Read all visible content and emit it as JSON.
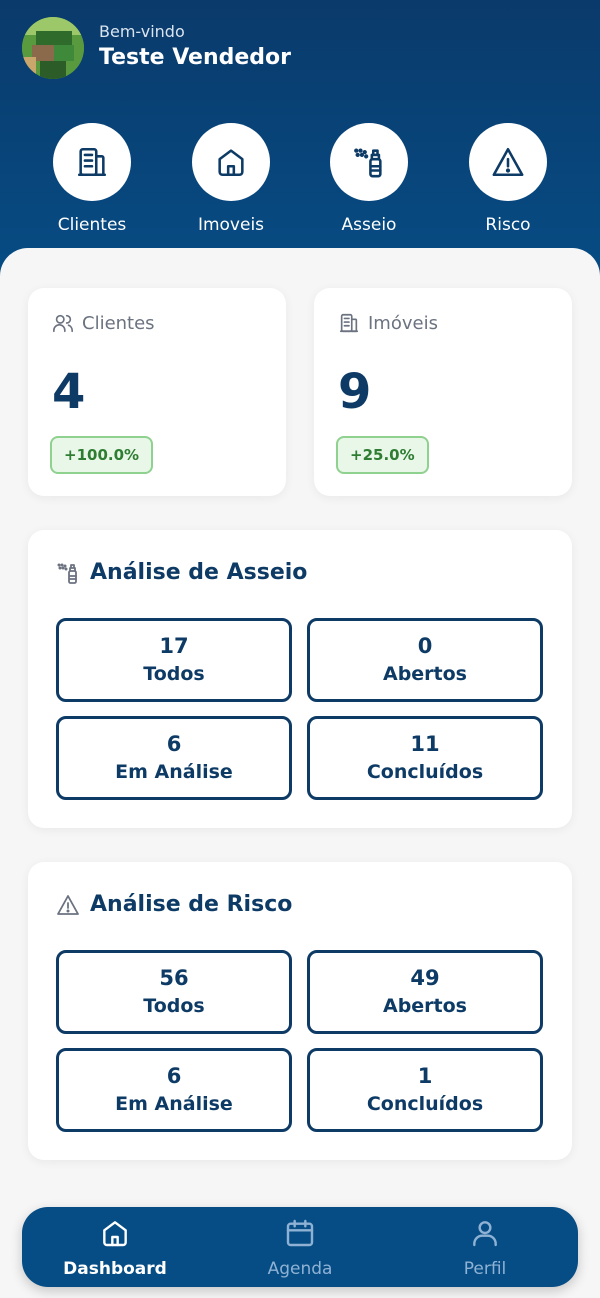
{
  "header": {
    "welcome": "Bem-vindo",
    "username": "Teste Vendedor"
  },
  "quick_actions": [
    {
      "label": "Clientes",
      "icon": "building-icon"
    },
    {
      "label": "Imoveis",
      "icon": "home-icon"
    },
    {
      "label": "Asseio",
      "icon": "spray-icon"
    },
    {
      "label": "Risco",
      "icon": "warning-icon"
    }
  ],
  "stats": [
    {
      "title": "Clientes",
      "value": "4",
      "change": "+100.0%",
      "icon": "users-icon"
    },
    {
      "title": "Imóveis",
      "value": "9",
      "change": "+25.0%",
      "icon": "building-icon"
    }
  ],
  "asseio": {
    "title": "Análise de Asseio",
    "tiles": [
      {
        "value": "17",
        "label": "Todos"
      },
      {
        "value": "0",
        "label": "Abertos"
      },
      {
        "value": "6",
        "label": "Em Análise"
      },
      {
        "value": "11",
        "label": "Concluídos"
      }
    ]
  },
  "risco": {
    "title": "Análise de Risco",
    "tiles": [
      {
        "value": "56",
        "label": "Todos"
      },
      {
        "value": "49",
        "label": "Abertos"
      },
      {
        "value": "6",
        "label": "Em Análise"
      },
      {
        "value": "1",
        "label": "Concluídos"
      }
    ]
  },
  "nav": [
    {
      "label": "Dashboard",
      "active": true
    },
    {
      "label": "Agenda",
      "active": false
    },
    {
      "label": "Perfil",
      "active": false
    }
  ],
  "colors": {
    "primary": "#0d3b66",
    "header": "#064d85",
    "badge_green": "#2e7d32"
  }
}
